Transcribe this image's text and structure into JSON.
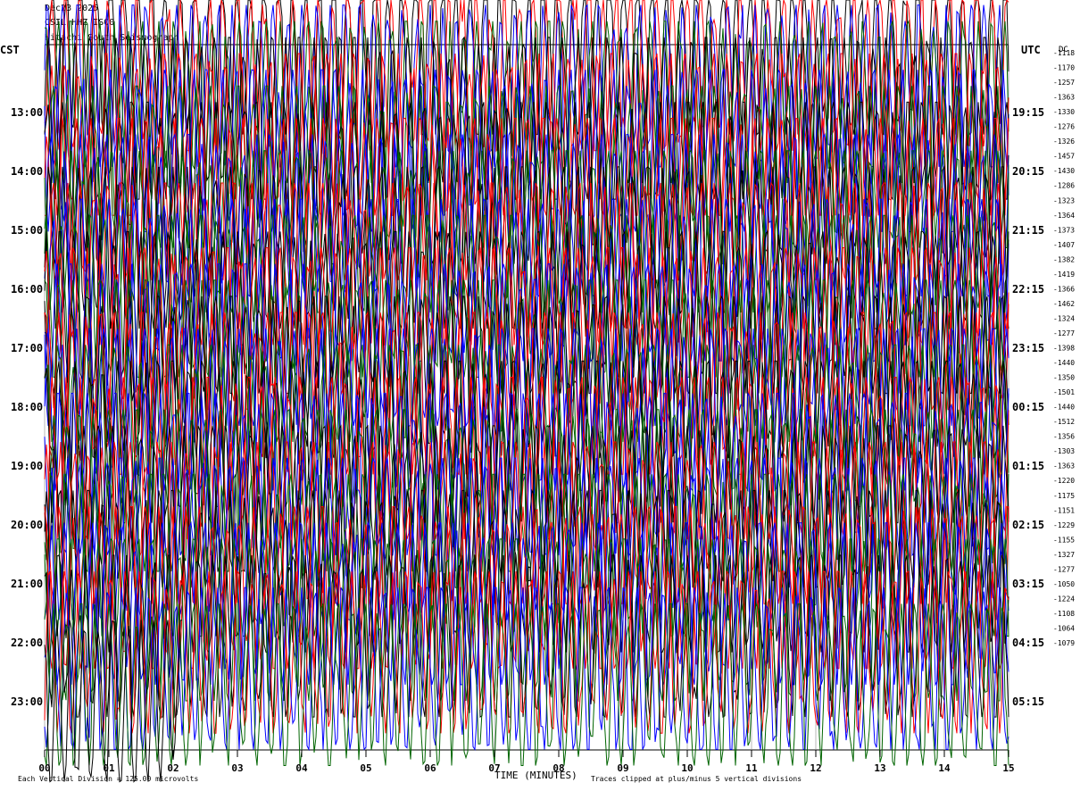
{
  "header": {
    "date": "Dec23 2025",
    "station": "CSIL HHZ IS00",
    "subtitle": "Hitachi South Seismograph"
  },
  "left_timezone": "CST",
  "right_timezone": "UTC",
  "dc_label": "DC",
  "footer": {
    "scale": "Each Vertical Division = 125.00 microvolts",
    "xlabel": "TIME (MINUTES)",
    "clip": "Traces clipped at plus/minus 5 vertical divisions"
  },
  "colors": {
    "black": "#000000",
    "red": "#ff0000",
    "blue": "#0000ff",
    "green": "#006400"
  },
  "chart_data": {
    "type": "line",
    "title": "Dec23 2025",
    "xlabel": "TIME (MINUTES)",
    "x_ticks": [
      "00",
      "01",
      "02",
      "03",
      "04",
      "05",
      "06",
      "07",
      "08",
      "09",
      "10",
      "11",
      "12",
      "13",
      "14",
      "15"
    ],
    "xlim": [
      0,
      15
    ],
    "left_hour_labels": [
      "13:00",
      "14:00",
      "15:00",
      "16:00",
      "17:00",
      "18:00",
      "19:00",
      "20:00",
      "21:00",
      "22:00",
      "23:00"
    ],
    "right_hour_labels": [
      "19:15",
      "20:15",
      "21:15",
      "22:15",
      "23:15",
      "00:15",
      "01:15",
      "02:15",
      "03:15",
      "04:15",
      "05:15"
    ],
    "trace_colors": [
      "black",
      "red",
      "blue",
      "green"
    ],
    "dc_offsets": [
      "-1118",
      "-1170",
      "-1257",
      "-1363",
      "-1330",
      "-1276",
      "-1326",
      "-1457",
      "-1430",
      "-1286",
      "-1323",
      "-1364",
      "-1373",
      "-1407",
      "-1382",
      "-1419",
      "-1366",
      "-1462",
      "-1324",
      "-1277",
      "-1398",
      "-1440",
      "-1350",
      "-1501",
      "-1440",
      "-1512",
      "-1356",
      "-1303",
      "-1363",
      "-1220",
      "-1175",
      "-1151",
      "-1229",
      "-1155",
      "-1327",
      "-1277",
      "-1050",
      "-1224",
      "-1108",
      "-1064",
      "-1079"
    ],
    "clip_divisions": 5,
    "microvolts_per_division": 125.0
  }
}
